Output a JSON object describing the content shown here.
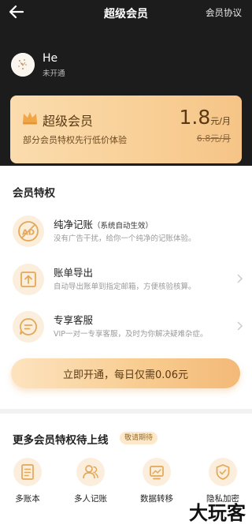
{
  "header": {
    "title": "超级会员",
    "agreement_label": "会员协议"
  },
  "user": {
    "name": "He",
    "status": "未开通"
  },
  "card": {
    "title": "超级会员",
    "description": "部分会员特权先行低价体验",
    "price": "1.8",
    "price_unit": "元/月",
    "original_price": "6.8元/月"
  },
  "privileges": {
    "section_title": "会员特权",
    "items": [
      {
        "title": "纯净记账",
        "note": "（系统自动生效）",
        "description": "没有广告干扰，给你一个纯净的记账体验。",
        "icon": "ad-free-icon"
      },
      {
        "title": "账单导出",
        "note": "",
        "description": "自动导出账单到指定邮箱，方便核验核算。",
        "icon": "export-icon"
      },
      {
        "title": "专享客服",
        "note": "",
        "description": "VIP一对一专享客服，及时为你解决疑难杂症。",
        "icon": "chat-icon"
      }
    ]
  },
  "cta": {
    "label": "立即开通，每日仅需0.06元"
  },
  "more": {
    "section_title": "更多会员特权待上线",
    "badge": "敬请期待",
    "features": [
      {
        "label": "多账本",
        "icon": "notebook-icon"
      },
      {
        "label": "多人记账",
        "icon": "users-icon"
      },
      {
        "label": "数据转移",
        "icon": "transfer-icon"
      },
      {
        "label": "隐私加密",
        "icon": "shield-icon"
      }
    ]
  },
  "watermark": "大玩客",
  "colors": {
    "header_bg": "#1c1c1c",
    "gold": "#f6c487",
    "gold_text": "#5a3a14"
  }
}
